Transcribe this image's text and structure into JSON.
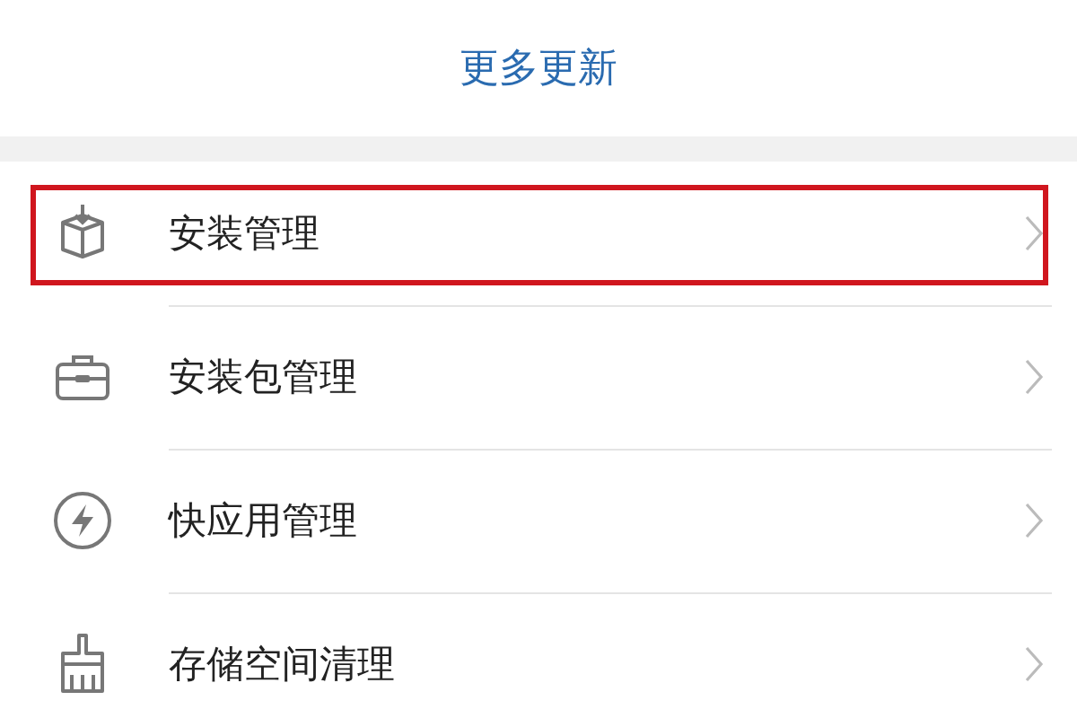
{
  "header": {
    "link": "更多更新"
  },
  "items": [
    {
      "kind": "install",
      "label": "安装管理",
      "highlighted": true
    },
    {
      "kind": "package",
      "label": "安装包管理",
      "highlighted": false
    },
    {
      "kind": "quickapp",
      "label": "快应用管理",
      "highlighted": false
    },
    {
      "kind": "storage",
      "label": "存储空间清理",
      "highlighted": false
    }
  ]
}
